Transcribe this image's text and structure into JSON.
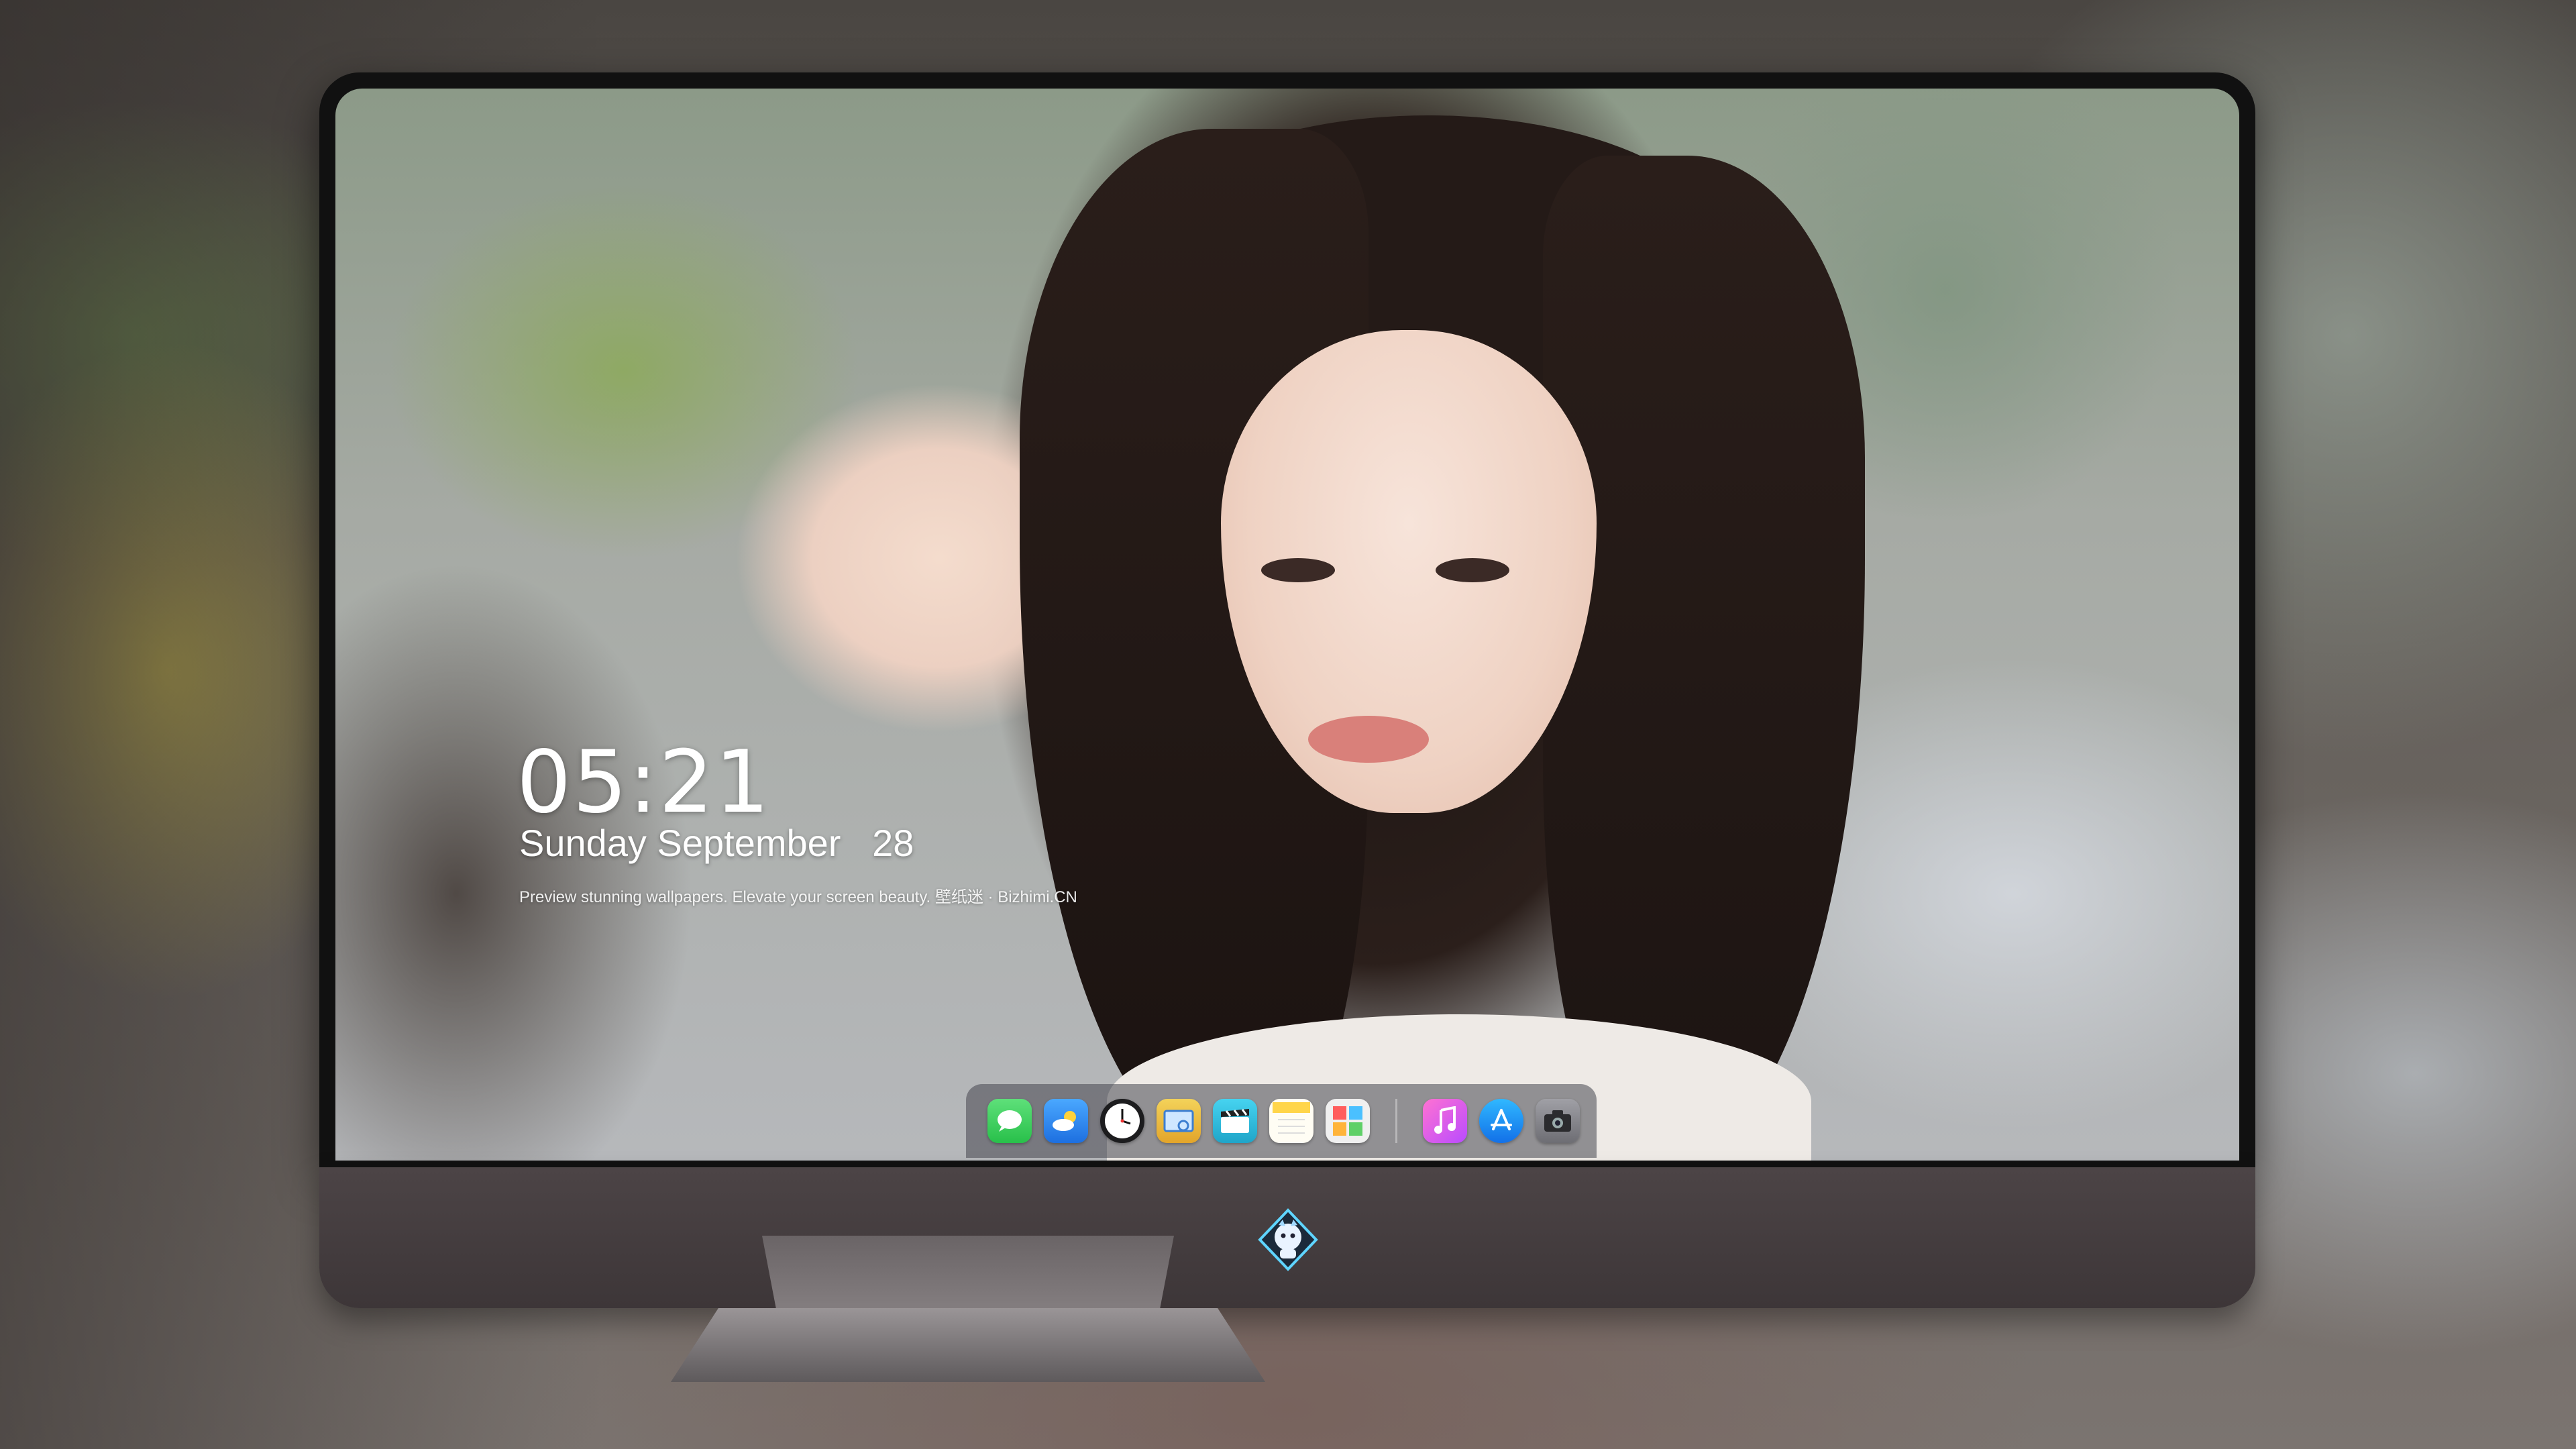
{
  "lockscreen": {
    "time": "05:21",
    "date": "Sunday September   28",
    "tagline": "Preview stunning wallpapers. Elevate your screen beauty. 壁纸迷 · Bizhimi.CN"
  },
  "dock": {
    "apps": [
      {
        "name": "messages-icon",
        "color": "#34c759"
      },
      {
        "name": "weather-icon",
        "color": "#2f8cf0"
      },
      {
        "name": "clock-icon",
        "color": "#1c1c1e"
      },
      {
        "name": "preview-icon",
        "color": "#4a90d9"
      },
      {
        "name": "claquette-icon",
        "color": "#2bb6d8"
      },
      {
        "name": "notes-icon",
        "color": "#ffd54a"
      },
      {
        "name": "photo-booth-icon",
        "color": "#e9e9ea"
      },
      {
        "name": "music-icon",
        "color": "#fa57c1"
      },
      {
        "name": "app-store-icon",
        "color": "#1a8cff"
      },
      {
        "name": "camera-icon",
        "color": "#8e8e93"
      }
    ]
  },
  "brand": {
    "logo": "dragon-mascot-logo"
  }
}
